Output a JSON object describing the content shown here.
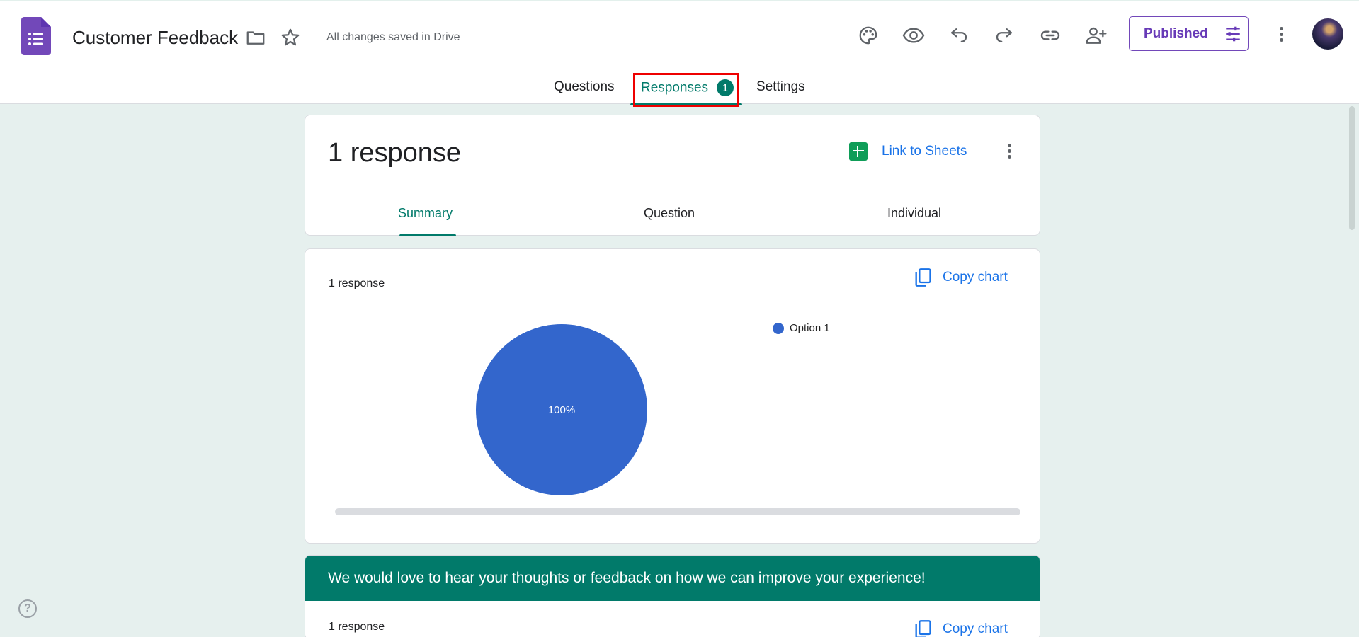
{
  "header": {
    "title": "Customer Feedback",
    "save_status": "All changes saved in Drive",
    "publish_label": "Published",
    "icons": [
      "forms-logo-icon",
      "folder-icon",
      "star-icon",
      "palette-icon",
      "preview-eye-icon",
      "undo-icon",
      "redo-icon",
      "link-icon",
      "add-collaborator-icon",
      "tune-icon",
      "more-vert-icon",
      "avatar"
    ]
  },
  "tabs": {
    "questions": "Questions",
    "responses": "Responses",
    "responses_count": "1",
    "settings": "Settings",
    "active": "responses"
  },
  "summary_card": {
    "title": "1 response",
    "link_sheets": "Link to Sheets",
    "subtabs": [
      "Summary",
      "Question",
      "Individual"
    ],
    "active_subtab": "Summary"
  },
  "chart_card": {
    "response_count": "1 response",
    "copy_label": "Copy chart"
  },
  "chart_data": {
    "type": "pie",
    "categories": [
      "Option 1"
    ],
    "values": [
      100
    ],
    "slice_labels": [
      "100%"
    ],
    "colors": [
      "#3366cc"
    ],
    "legend_position": "right"
  },
  "question_card": {
    "title": "We would love to hear your thoughts or feedback on how we can improve your experience!",
    "response_count": "1 response",
    "copy_label": "Copy chart"
  },
  "colors": {
    "accent": "#017a6a",
    "brand_purple": "#673ab7",
    "link_blue": "#1a73e8",
    "background": "#e6f0ee"
  }
}
